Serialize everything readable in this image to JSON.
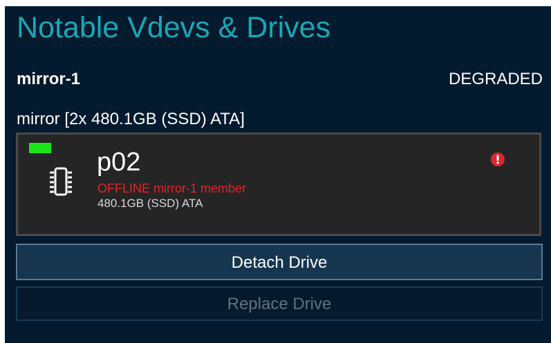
{
  "header": {
    "title": "Notable Vdevs & Drives"
  },
  "vdev": {
    "name": "mirror-1",
    "status": "DEGRADED",
    "description": "mirror [2x 480.1GB (SSD) ATA]"
  },
  "drive": {
    "name": "p02",
    "state": "OFFLINE mirror-1 member",
    "info": "480.1GB (SSD) ATA",
    "led_color": "#19e619",
    "state_color": "#e2242c",
    "icon": "chip-icon",
    "alert_icon": "alert-icon"
  },
  "actions": {
    "detach_label": "Detach Drive",
    "replace_label": "Replace Drive",
    "replace_enabled": false
  },
  "colors": {
    "accent": "#1aa7b5",
    "background": "#041a2e"
  }
}
